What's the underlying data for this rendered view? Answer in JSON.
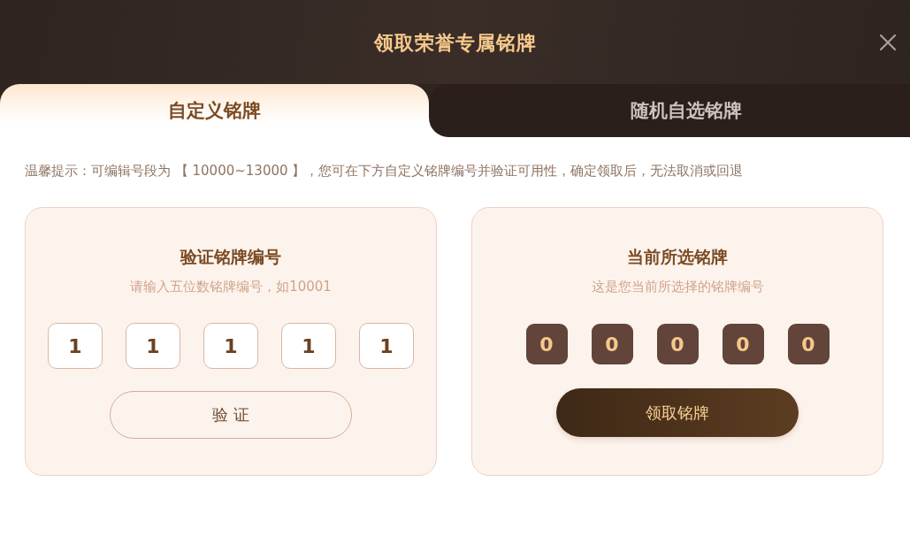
{
  "dialog": {
    "title": "领取荣誉专属铭牌"
  },
  "tabs": [
    {
      "label": "自定义铭牌",
      "selected": true
    },
    {
      "label": "随机自选铭牌",
      "selected": false
    }
  ],
  "notice": "温馨提示：可编辑号段为 【 10000~13000 】，您可在下方自定义铭牌编号并验证可用性，确定领取后，无法取消或回退",
  "panels": [
    {
      "kind": "verify",
      "title": "验证铭牌编号",
      "subtitle": "请输入五位数铭牌编号，如10001",
      "digits": [
        "1",
        "1",
        "1",
        "1",
        "1"
      ],
      "button": "验 证"
    },
    {
      "kind": "current",
      "title": "当前所选铭牌",
      "subtitle": "这是您当前所选择的铭牌编号",
      "digits": [
        "0",
        "0",
        "0",
        "0",
        "0"
      ],
      "button": "领取铭牌"
    }
  ]
}
